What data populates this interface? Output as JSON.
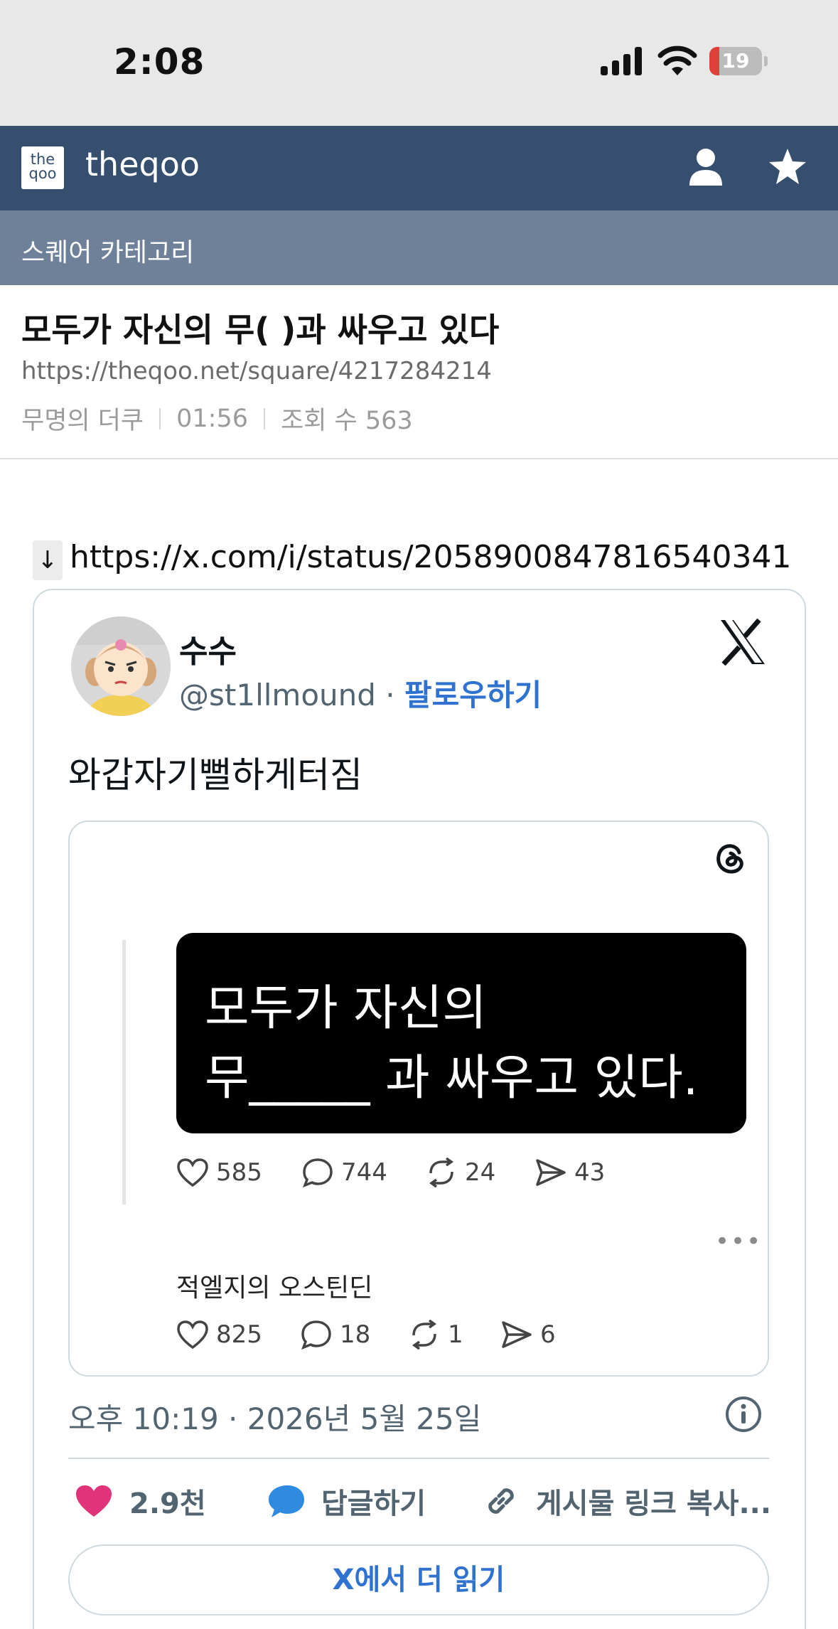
{
  "status_bar": {
    "time": "2:08",
    "battery": "19",
    "battery_level": 0.19,
    "battery_color": "#e0403a"
  },
  "app": {
    "logo_text_top": "the",
    "logo_text_bottom": "qoo",
    "title": "theqoo",
    "header_color": "#364f6f",
    "icons": [
      "user-icon",
      "star-icon"
    ]
  },
  "subbar": {
    "label": "스퀘어 카테고리",
    "color": "#6f8198"
  },
  "post": {
    "title": "모두가 자신의 무( )과 싸우고 있다",
    "url": "https://theqoo.net/square/4217284214",
    "author": "무명의 더쿠",
    "time": "01:56",
    "views": "조회 수 563"
  },
  "tweet_link": {
    "arrow": "↓",
    "url": "https://x.com/i/status/2058900847816540341"
  },
  "tweet": {
    "author_name": "수수",
    "handle": "@st1llmound",
    "separator": " · ",
    "follow_label": "팔로우하기",
    "text": "와갑자기뻘하게터짐",
    "quote": {
      "image_line1": "모두가 자신의",
      "image_line2": "무_____ 과  싸우고 있다.",
      "stats": {
        "likes": "585",
        "replies": "744",
        "reposts": "24",
        "shares": "43"
      },
      "more": "•••",
      "reply_author": "적엘지의 오스틴딘",
      "reply_stats": {
        "likes": "825",
        "replies": "18",
        "reposts": "1",
        "shares": "6"
      }
    },
    "date": "오후 10:19 · 2026년 5월 25일",
    "actions": {
      "likes": "2.9천",
      "reply": "답글하기",
      "copy_link": "게시물 링크 복사..."
    },
    "read_more": "X에서 더 읽기",
    "like_color": "#e0337a",
    "reply_color": "#2f8be0",
    "link_color": "#2f72d0"
  }
}
